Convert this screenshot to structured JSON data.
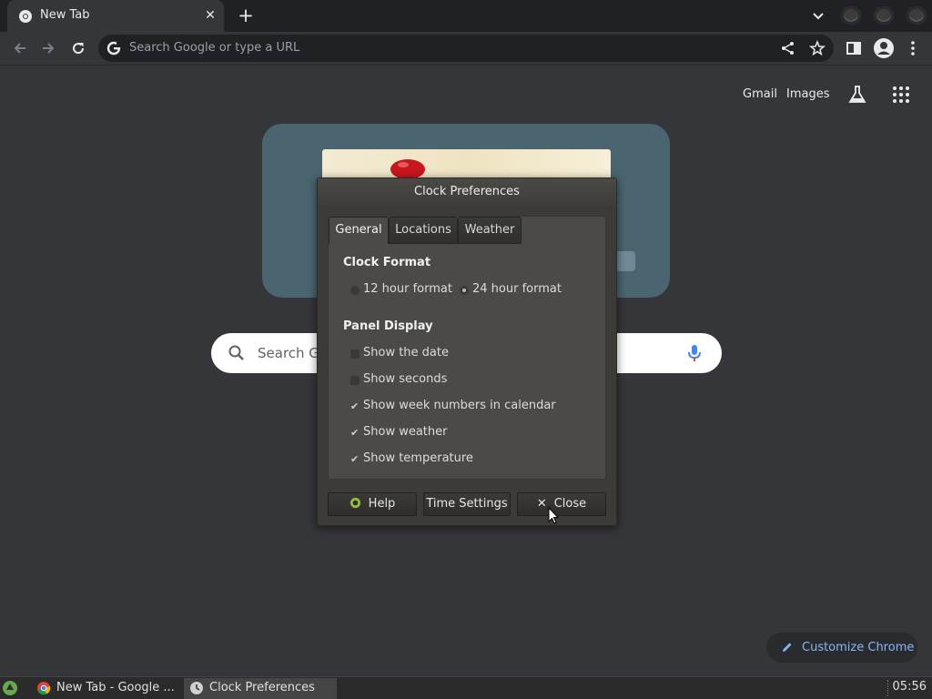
{
  "browser": {
    "tab_title": "New Tab",
    "omnibox_placeholder": "Search Google or type a URL"
  },
  "ntp": {
    "links": {
      "gmail": "Gmail",
      "images": "Images"
    },
    "search_placeholder": "Search G",
    "customize_label": "Customize Chrome"
  },
  "dialog": {
    "title": "Clock Preferences",
    "tabs": [
      "General",
      "Locations",
      "Weather"
    ],
    "active_tab": "General",
    "clock_format": {
      "heading": "Clock Format",
      "options": [
        {
          "label": "12 hour format",
          "selected": false
        },
        {
          "label": "24 hour format",
          "selected": true
        }
      ]
    },
    "panel_display": {
      "heading": "Panel Display",
      "options": [
        {
          "label": "Show the date",
          "checked": false
        },
        {
          "label": "Show seconds",
          "checked": false
        },
        {
          "label": "Show week numbers in calendar",
          "checked": true
        },
        {
          "label": "Show weather",
          "checked": true
        },
        {
          "label": "Show temperature",
          "checked": true
        }
      ]
    },
    "buttons": {
      "help": "Help",
      "time_settings": "Time Settings",
      "close": "Close"
    }
  },
  "taskbar": {
    "items": [
      {
        "label": "New Tab - Google ..."
      },
      {
        "label": "Clock Preferences"
      }
    ],
    "clock": "05:56"
  },
  "colors": {
    "chrome_dark": "#202124",
    "ntp_background": "#35363a",
    "link_blue": "#8ab4f8",
    "dialog_background": "#3c3b37"
  }
}
